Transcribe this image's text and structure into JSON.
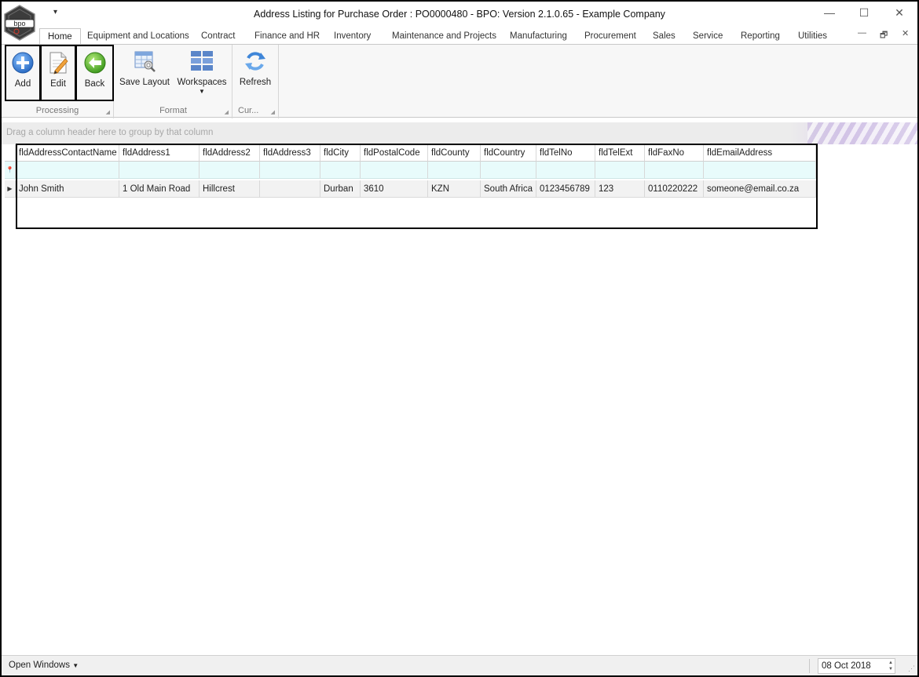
{
  "window": {
    "title": "Address Listing for Purchase Order : PO0000480 - BPO: Version 2.1.0.65 - Example Company",
    "logo_text": "bpo",
    "quick_access": "▾",
    "controls": {
      "minimize": "—",
      "maximize": "☐",
      "close": "✕"
    },
    "mdi_controls": {
      "minimize": "—",
      "restore": "🗗",
      "close": "✕"
    }
  },
  "ribbon_tabs": [
    {
      "label": "Home",
      "active": true
    },
    {
      "label": "Equipment and Locations"
    },
    {
      "label": "Contract"
    },
    {
      "label": "Finance and HR"
    },
    {
      "label": "Inventory"
    },
    {
      "label": "Maintenance and Projects"
    },
    {
      "label": "Manufacturing"
    },
    {
      "label": "Procurement"
    },
    {
      "label": "Sales"
    },
    {
      "label": "Service"
    },
    {
      "label": "Reporting"
    },
    {
      "label": "Utilities"
    }
  ],
  "ribbon": {
    "processing": {
      "label": "Processing",
      "add": "Add",
      "edit": "Edit",
      "back": "Back"
    },
    "format": {
      "label": "Format",
      "save_layout": "Save Layout",
      "workspaces": "Workspaces"
    },
    "current": {
      "label": "Cur...",
      "refresh": "Refresh"
    }
  },
  "grid": {
    "group_hint": "Drag a column header here to group by that column",
    "columns": [
      "fldAddressContactName",
      "fldAddress1",
      "fldAddress2",
      "fldAddress3",
      "fldCity",
      "fldPostalCode",
      "fldCounty",
      "fldCountry",
      "fldTelNo",
      "fldTelExt",
      "fldFaxNo",
      "fldEmailAddress"
    ],
    "rows": [
      [
        "John Smith",
        "1 Old Main Road",
        "Hillcrest",
        "",
        "Durban",
        "3610",
        "KZN",
        "South Africa",
        "0123456789",
        "123",
        "0110220222",
        "someone@email.co.za"
      ]
    ]
  },
  "statusbar": {
    "open_windows": "Open Windows",
    "date": "08 Oct 2018"
  },
  "colors": {
    "filter_row": "#e8fbfb",
    "add_icon": "#3a7fd6",
    "back_icon": "#5db632",
    "highlight_border": "#000000"
  }
}
